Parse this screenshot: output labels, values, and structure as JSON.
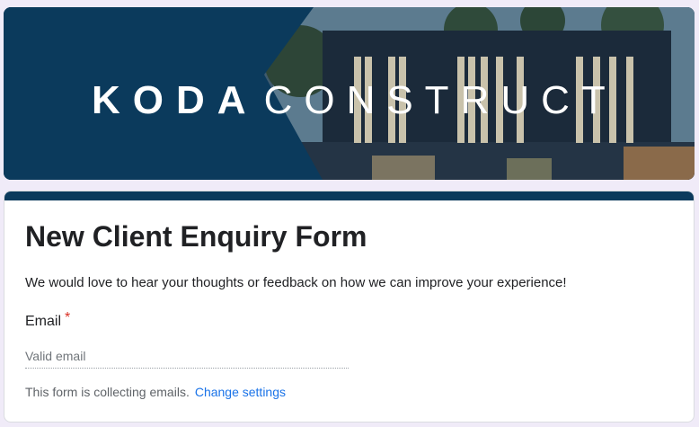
{
  "banner": {
    "brand_bold": "KODA",
    "brand_light": "CONSTRUCT"
  },
  "form": {
    "title": "New Client Enquiry Form",
    "description": "We would love to hear your thoughts or feedback on how we can improve your experience!",
    "email_label": "Email",
    "required_mark": "*",
    "email_placeholder": "Valid email",
    "email_value": "",
    "collecting_text": "This form is collecting emails.",
    "change_settings_link": "Change settings"
  },
  "colors": {
    "brand_navy": "#0b3a5c",
    "page_background": "#f0ebf8",
    "link_blue": "#1a73e8",
    "required_red": "#d93025"
  }
}
